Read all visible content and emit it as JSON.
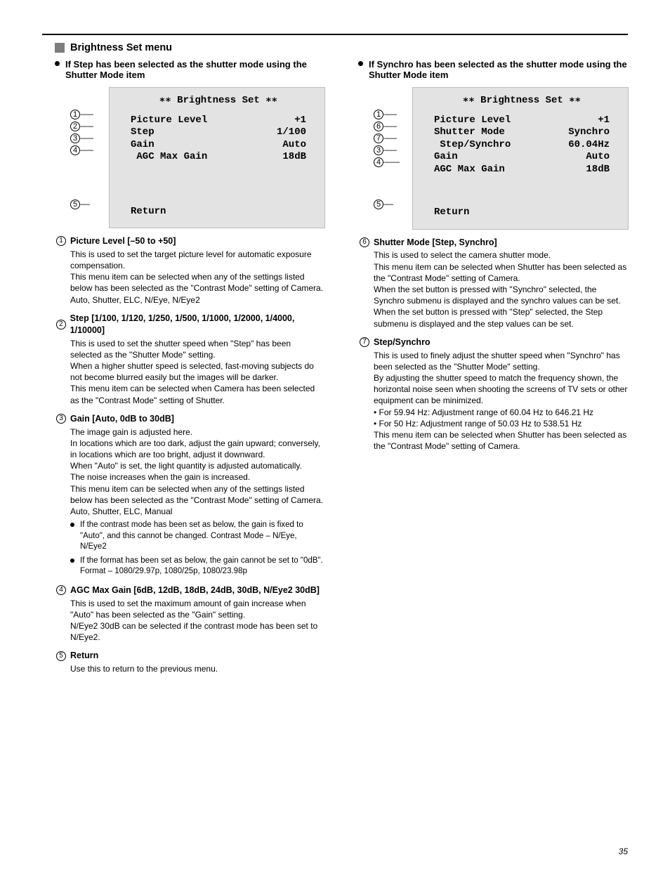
{
  "section_title": "Brightness Set menu",
  "headings": {
    "left": "If Step has been selected as the shutter mode using the Shutter Mode item",
    "right": "If Synchro has been selected as the shutter mode using the Shutter Mode item"
  },
  "osd": {
    "title": "∗∗ Brightness Set ∗∗",
    "left_rows": [
      {
        "label": "Picture Level",
        "value": "+1"
      },
      {
        "label": "Step",
        "value": "1/100"
      },
      {
        "label": "Gain",
        "value": "Auto"
      },
      {
        "label": " AGC Max Gain",
        "value": "18dB"
      }
    ],
    "left_return": "Return",
    "left_callouts": [
      "1",
      "2",
      "3",
      "4",
      "5"
    ],
    "right_rows": [
      {
        "label": "Picture Level",
        "value": "+1"
      },
      {
        "label": "Shutter Mode",
        "value": "Synchro"
      },
      {
        "label": " Step/Synchro",
        "value": "60.04Hz"
      },
      {
        "label": "Gain",
        "value": "Auto"
      },
      {
        "label": "AGC Max Gain",
        "value": "18dB"
      }
    ],
    "right_return": "Return",
    "right_callouts": [
      "1",
      "6",
      "7",
      "3",
      "4",
      "5"
    ]
  },
  "items": {
    "i1": {
      "title": "Picture Level [–50 to +50]",
      "body": "This is used to set the target picture level for automatic exposure compensation.\nThis menu item can be selected when any of the settings listed below has been selected as the \"Contrast Mode\" setting of Camera.\nAuto, Shutter, ELC, N/Eye, N/Eye2"
    },
    "i2": {
      "title": "Step [1/100, 1/120, 1/250, 1/500, 1/1000, 1/2000, 1/4000, 1/10000]",
      "body": "This is used to set the shutter speed when \"Step\" has been selected as the \"Shutter Mode\" setting.\nWhen a higher shutter speed is selected, fast-moving subjects do not become blurred easily but the images will be darker.\nThis menu item can be selected when Camera has been selected as the \"Contrast Mode\" setting of Shutter."
    },
    "i3": {
      "title": "Gain [Auto, 0dB to 30dB]",
      "body": "The image gain is adjusted here.\nIn locations which are too dark, adjust the gain upward; conversely, in locations which are too bright, adjust it downward.\nWhen \"Auto\" is set, the light quantity is adjusted automatically.\nThe noise increases when the gain is increased.\nThis menu item can be selected when any of the settings listed below has been selected as the \"Contrast Mode\" setting of Camera.\nAuto, Shutter, ELC, Manual",
      "notes": [
        "If the contrast mode has been set as below, the gain is fixed to \"Auto\", and this cannot be changed. Contrast Mode – N/Eye, N/Eye2",
        "If the format has been set as below, the gain cannot be set to \"0dB\". Format – 1080/29.97p, 1080/25p, 1080/23.98p"
      ]
    },
    "i4": {
      "title": "AGC Max Gain [6dB, 12dB, 18dB, 24dB, 30dB, N/Eye2 30dB]",
      "body": "This is used to set the maximum amount of gain increase when \"Auto\" has been selected as the \"Gain\" setting.\nN/Eye2 30dB can be selected if the contrast mode has been set to N/Eye2."
    },
    "i5": {
      "title": "Return",
      "body": "Use this to return to the previous menu."
    },
    "i6": {
      "title": "Shutter Mode [Step, Synchro]",
      "body": "This is used to select the camera shutter mode.\nThis menu item can be selected when Shutter has been selected as the \"Contrast Mode\" setting of Camera.\nWhen the set button is pressed with \"Synchro\" selected, the Synchro submenu is displayed and the synchro values can be set.\nWhen the set button is pressed with \"Step\" selected, the Step submenu is displayed and the step values can be set."
    },
    "i7": {
      "title": "Step/Synchro",
      "body": "This is used to finely adjust the shutter speed when \"Synchro\" has been selected as the \"Shutter Mode\" setting.\nBy adjusting the shutter speed to match the frequency shown, the horizontal noise seen when shooting the screens of TV sets or other equipment can be minimized.\n• For 59.94 Hz: Adjustment range of 60.04 Hz to 646.21 Hz\n• For 50 Hz: Adjustment range of 50.03 Hz to 538.51 Hz\nThis menu item can be selected when Shutter has been selected as the \"Contrast Mode\" setting of Camera."
    }
  },
  "page_number": "35"
}
